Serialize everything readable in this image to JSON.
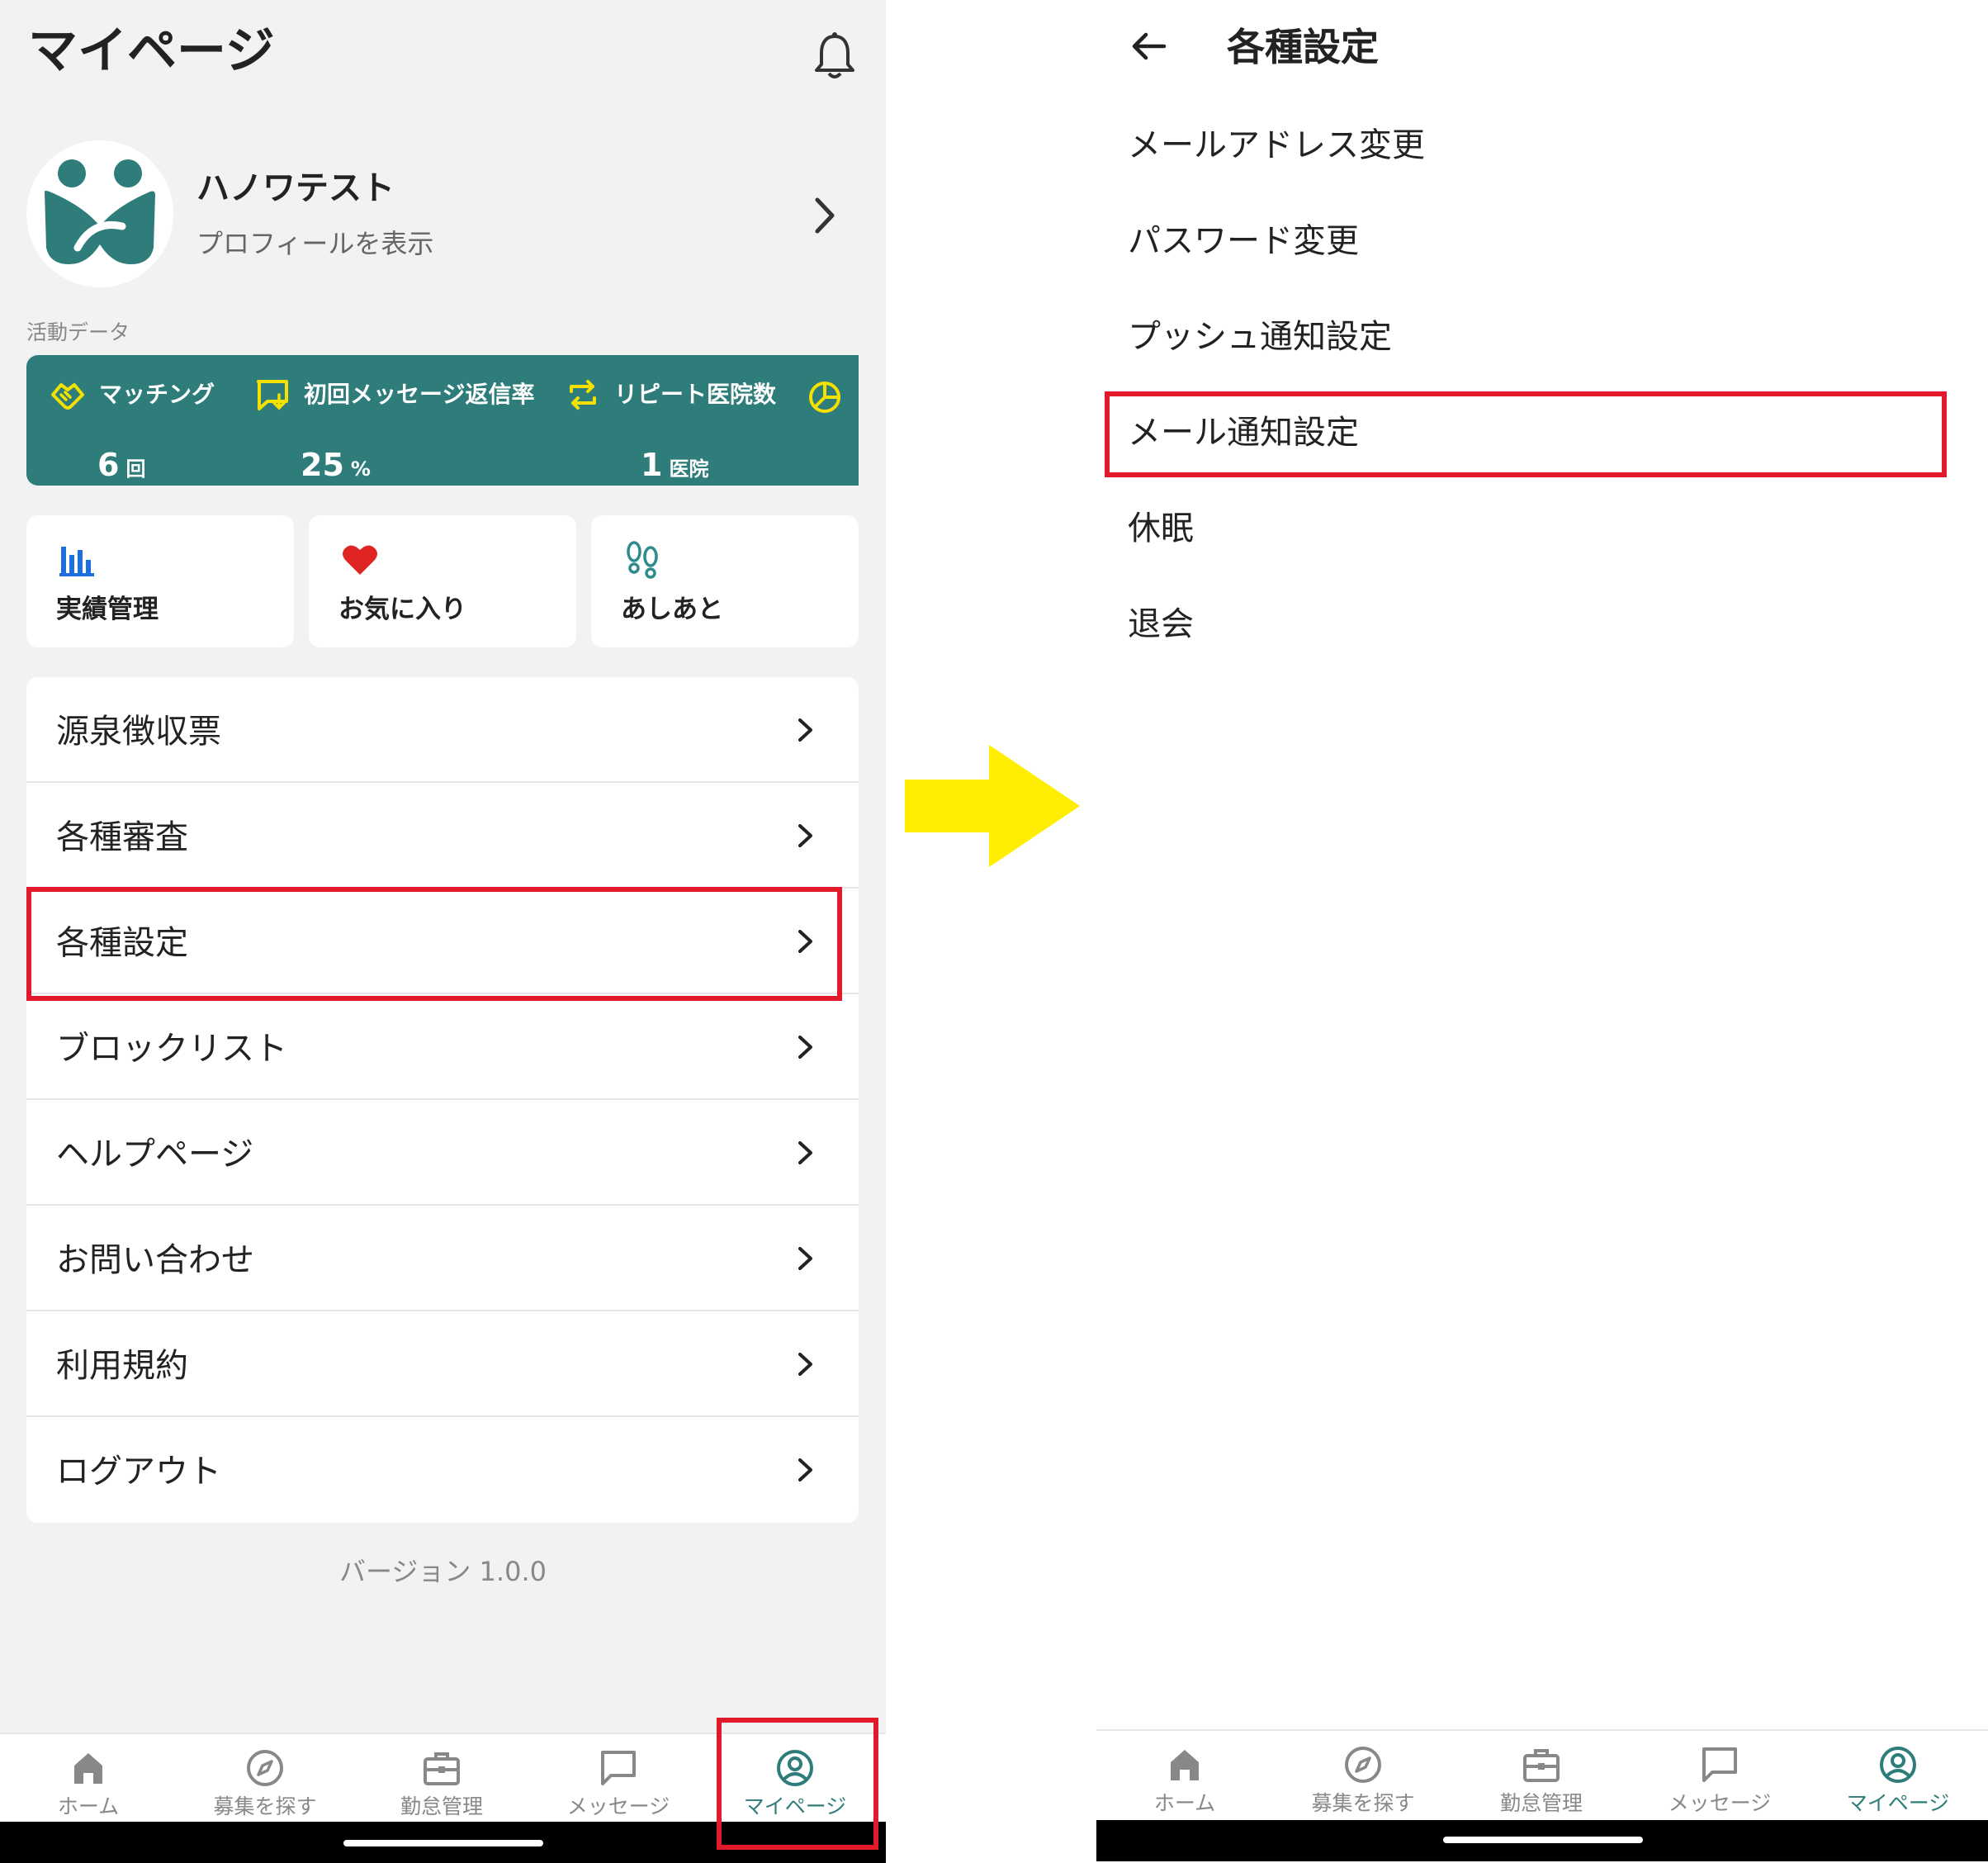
{
  "left": {
    "title": "マイページ",
    "profile": {
      "name": "ハノワテスト",
      "subtitle": "プロフィールを表示"
    },
    "activity_label": "活動データ",
    "stats": [
      {
        "label": "マッチング",
        "value": "6",
        "unit": "回",
        "icon": "handshake-icon"
      },
      {
        "label": "初回メッセージ返信率",
        "value": "25",
        "unit": "%",
        "icon": "reply-icon"
      },
      {
        "label": "リピート医院数",
        "value": "1",
        "unit": "医院",
        "icon": "repeat-icon"
      }
    ],
    "cards": [
      {
        "label": "実績管理",
        "icon": "bar-chart-icon"
      },
      {
        "label": "お気に入り",
        "icon": "heart-icon"
      },
      {
        "label": "あしあと",
        "icon": "footprints-icon"
      }
    ],
    "menu": [
      {
        "label": "源泉徴収票"
      },
      {
        "label": "各種審査"
      },
      {
        "label": "各種設定"
      },
      {
        "label": "ブロックリスト"
      },
      {
        "label": "ヘルプページ"
      },
      {
        "label": "お問い合わせ"
      },
      {
        "label": "利用規約"
      },
      {
        "label": "ログアウト"
      }
    ],
    "version": "バージョン 1.0.0"
  },
  "tabs": [
    {
      "label": "ホーム",
      "icon": "home-icon"
    },
    {
      "label": "募集を探す",
      "icon": "compass-icon"
    },
    {
      "label": "勤怠管理",
      "icon": "briefcase-icon"
    },
    {
      "label": "メッセージ",
      "icon": "chat-icon"
    },
    {
      "label": "マイページ",
      "icon": "user-circle-icon",
      "active": true
    }
  ],
  "right": {
    "title": "各種設定",
    "items": [
      {
        "label": "メールアドレス変更"
      },
      {
        "label": "パスワード変更"
      },
      {
        "label": "プッシュ通知設定"
      },
      {
        "label": "メール通知設定"
      },
      {
        "label": "休眠"
      },
      {
        "label": "退会"
      }
    ]
  },
  "colors": {
    "brand": "#2e7d7a",
    "stats_accent": "#f5e100",
    "highlight_box": "#e01a2b",
    "arrow": "#ffee00",
    "heart": "#e02424",
    "chart_blue": "#1e6fd9"
  }
}
